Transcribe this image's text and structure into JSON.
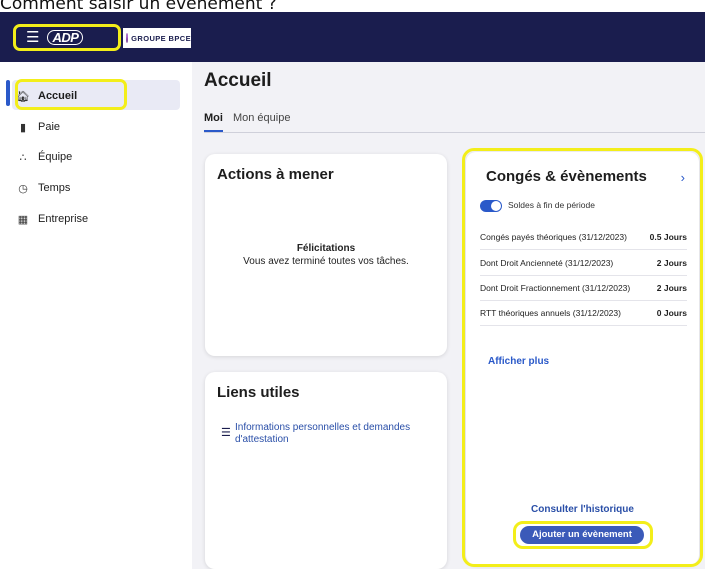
{
  "caption": "Comment saisir un évènement ?",
  "topbar": {
    "menu_icon": "hamburger-icon",
    "adp_logo": "ADP",
    "brand": "GROUPE BPCE",
    "bg_color": "#1a1d4e",
    "highlight_color": "#f3ee1a"
  },
  "sidebar": {
    "items": [
      {
        "label": "Accueil",
        "icon": "home-icon"
      },
      {
        "label": "Paie",
        "icon": "money-icon"
      },
      {
        "label": "Équipe",
        "icon": "team-icon"
      },
      {
        "label": "Temps",
        "icon": "clock-icon"
      },
      {
        "label": "Entreprise",
        "icon": "building-icon"
      }
    ],
    "accent_color": "#2a59c9"
  },
  "main": {
    "title": "Accueil",
    "tabs": [
      {
        "label": "Moi",
        "active": true
      },
      {
        "label": "Mon équipe",
        "active": false
      }
    ]
  },
  "actions_card": {
    "title": "Actions à mener",
    "message_title": "Félicitations",
    "message_body": "Vous avez terminé toutes vos tâches."
  },
  "liens_card": {
    "title": "Liens utiles",
    "links": [
      {
        "label": "Informations personnelles et demandes d'attestation",
        "icon": "database-icon"
      }
    ]
  },
  "conges_card": {
    "title": "Congés & évènements",
    "toggle_label": "Soldes à fin de période",
    "toggle_on": true,
    "balances": [
      {
        "label": "Congés payés théoriques (31/12/2023)",
        "value": "0.5 Jours"
      },
      {
        "label": "Dont Droit Ancienneté (31/12/2023)",
        "value": "2 Jours"
      },
      {
        "label": "Dont Droit Fractionnement (31/12/2023)",
        "value": "2 Jours"
      },
      {
        "label": "RTT théoriques annuels (31/12/2023)",
        "value": "0 Jours"
      }
    ],
    "show_more": "Afficher plus",
    "history_link": "Consulter l'historique",
    "add_button": "Ajouter un évènement"
  }
}
